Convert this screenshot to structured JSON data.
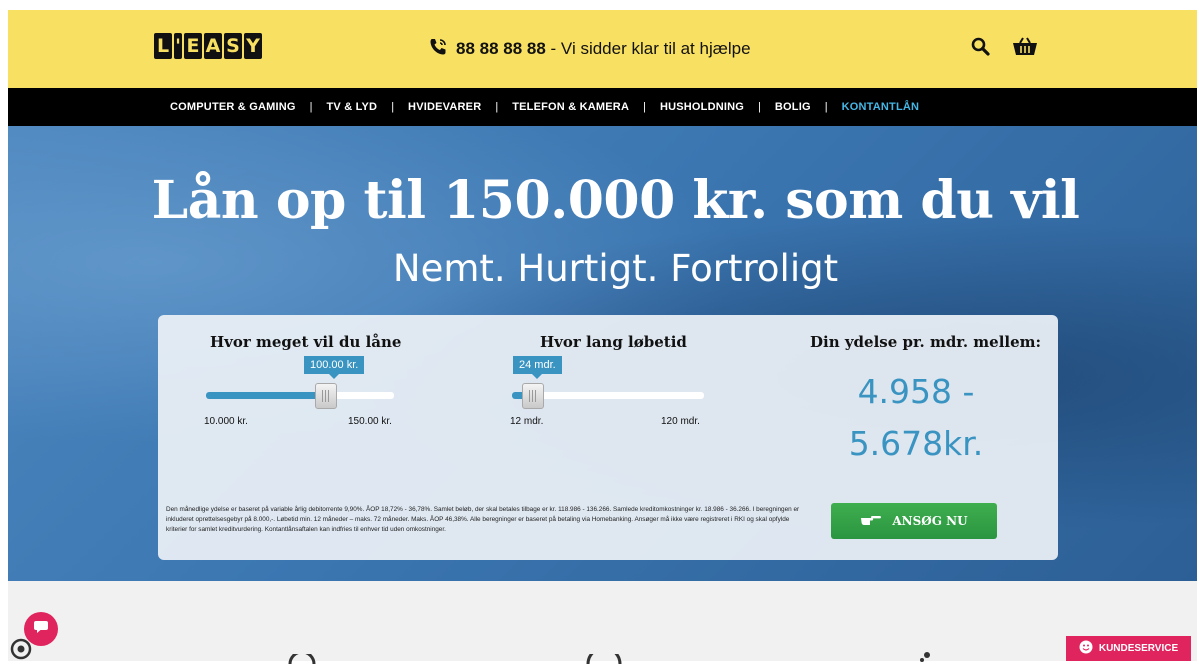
{
  "header": {
    "logo_letters": [
      "L",
      "'",
      "E",
      "A",
      "S",
      "Y"
    ],
    "phone_number": "88 88 88 88",
    "phone_text": " - Vi sidder klar til at hjælpe",
    "icons": [
      "phone-icon",
      "search-icon",
      "basket-icon"
    ]
  },
  "nav": {
    "items": [
      {
        "label": "COMPUTER & GAMING",
        "sep": "|"
      },
      {
        "label": "TV & LYD",
        "sep": "|"
      },
      {
        "label": "HVIDEVARER",
        "sep": "|"
      },
      {
        "label": "TELEFON & KAMERA",
        "sep": "|"
      },
      {
        "label": "HUSHOLDNING",
        "sep": "|"
      },
      {
        "label": "BOLIG",
        "sep": "|"
      },
      {
        "label": "KONTANTLÅN",
        "sep": ""
      }
    ],
    "accent_color": "#45b7e6"
  },
  "hero": {
    "title": "Lån op til 150.000 kr. som du vil",
    "subtitle": "Nemt. Hurtigt. Fortroligt"
  },
  "calculator": {
    "amount": {
      "title": "Hvor meget vil du låne",
      "value": "100.00 kr.",
      "min_label": "10.000 kr.",
      "max_label": "150.00 kr.",
      "position": 0.64
    },
    "term": {
      "title": "Hvor lang løbetid",
      "value": "24 mdr.",
      "min_label": "12 mdr.",
      "max_label": "120 mdr.",
      "position": 0.11
    },
    "result": {
      "title": "Din ydelse pr. mdr. mellem:",
      "line1": "4.958 -",
      "line2": "5.678kr."
    },
    "disclaimer": "Den månedlige ydelse er baseret på variable årlig debitorrente 9,90%. ÅOP 18,72% - 36,78%. Samlet beløb, der skal betales tilbage er kr. 118.986 - 136.266. Samlede kreditomkostninger kr. 18.986 - 36.266. I beregningen er inkluderet oprettelsesgebyr på 8.000,-. Løbetid min. 12 måneder – maks. 72 måneder. Maks. ÅOP 46,38%. Alle beregninger er baseret på betaling via Homebanking. Ansøger må ikke være registreret i RKI og skal opfylde kriterier for samlet kreditvurdering. Kontantlånsaftalen kan indfries til enhver tid uden omkostninger.",
    "apply_label": "ANSØG NU"
  },
  "support": {
    "label": "KUNDESERVICE"
  },
  "colors": {
    "header_yellow": "#f8e063",
    "accent_blue": "#3a94c2",
    "apply_green": "#2a9540",
    "support_pink": "#e0245e"
  }
}
